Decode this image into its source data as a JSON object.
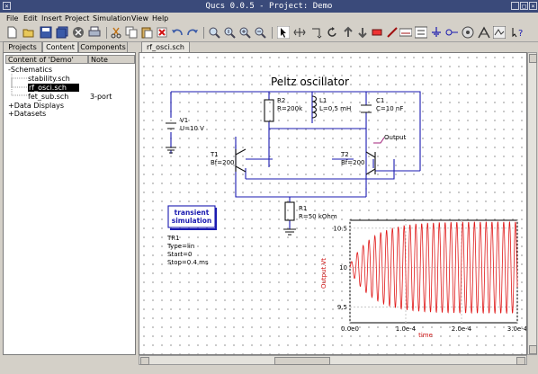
{
  "window": {
    "title": "Qucs 0.0.5 - Project: Demo"
  },
  "menu": [
    "File",
    "Edit",
    "Insert",
    "Project",
    "Simulation",
    "View",
    "Help"
  ],
  "left_tabs": [
    "Projects",
    "Content",
    "Components"
  ],
  "tree": {
    "header_col1": "Content of 'Demo'",
    "header_col2": "Note",
    "schematics": "Schematics",
    "stability": "stability.sch",
    "rf_osci": "rf_osci.sch",
    "fet_sub": "fet_sub.sch",
    "fet_note": "3-port",
    "data_displays": "Data Displays",
    "datasets": "Datasets",
    "expander_open": "-",
    "expander_closed": "+"
  },
  "document_tab": "rf_osci.sch",
  "schematic": {
    "title": "Peltz oscillator",
    "v1_name": "V1",
    "v1_val": "U=10 V",
    "r2_name": "R2",
    "r2_val": "R=200k",
    "l1_name": "L1",
    "l1_val": "L=0.5 mH",
    "c1_name": "C1",
    "c1_val": "C=10 nF",
    "output_label": "Output",
    "t1_name": "T1",
    "t1_val": "Bf=200",
    "t2_name": "T2",
    "t2_val": "Bf=200",
    "r1_name": "R1",
    "r1_val": "R=50 kOhm",
    "sim_box_line1": "transient",
    "sim_box_line2": "simulation",
    "tr1_name": "TR1",
    "tr1_type": "Type=lin",
    "tr1_start": "Start=0",
    "tr1_stop": "Stop=0.4 ms"
  },
  "chart_data": {
    "type": "line",
    "xlabel": "time",
    "ylabel": "Output.Vt",
    "xlim": [
      0,
      0.0003
    ],
    "ylim": [
      9.3,
      10.6
    ],
    "x_ticks": [
      "0.0e0",
      "1.0e-4",
      "2.0e-4",
      "3.0e-4"
    ],
    "y_ticks": [
      "10.5",
      "10",
      "9.5"
    ],
    "grid": true,
    "line_color": "#e01818",
    "series": [
      {
        "name": "Output.Vt",
        "center": 10.0,
        "period": 1.05e-05,
        "amplitude_start": 0.04,
        "amplitude_final": 0.58,
        "growth_time_constant": 4e-05
      }
    ]
  },
  "colors": {
    "title_bar": "#3a4a7a",
    "wire": "#1a1ab0",
    "output_wire": "#a0227a",
    "sim_box": "#1a1ab0"
  },
  "icons": [
    "new-file-icon",
    "open-icon",
    "save-icon",
    "save-all-icon",
    "close-icon",
    "print-icon",
    "cut-icon",
    "copy-icon",
    "paste-icon",
    "delete-icon",
    "undo-icon",
    "redo-icon",
    "zoom-fit-icon",
    "zoom-1to1-icon",
    "zoom-in-icon",
    "zoom-out-icon",
    "select-icon",
    "mirror-x-icon",
    "mirror-y-icon",
    "rotate-icon",
    "enter-subcircuit-icon",
    "leave-subcircuit-icon",
    "deactivate-icon",
    "wire-icon",
    "wire-label-icon",
    "equation-icon",
    "ground-icon",
    "port-icon",
    "simulate-icon",
    "view-data-icon",
    "marker-icon",
    "whats-this-icon"
  ]
}
